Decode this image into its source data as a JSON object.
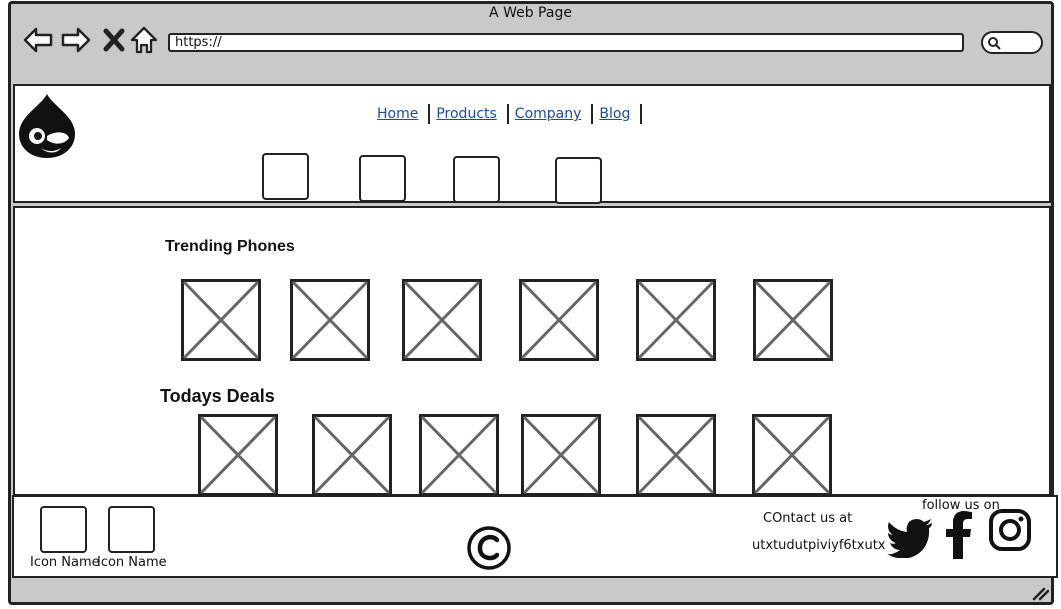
{
  "browser": {
    "window_title": "A Web Page",
    "url": "https://",
    "back_icon": "arrow-left-icon",
    "forward_icon": "arrow-right-icon",
    "stop_icon": "close-icon",
    "home_icon": "home-icon",
    "search_icon": "search-icon"
  },
  "header": {
    "logo_icon": "drupal-drop-icon",
    "nav_links": [
      {
        "label": "Home"
      },
      {
        "label": "Products"
      },
      {
        "label": "Company"
      },
      {
        "label": "Blog"
      }
    ]
  },
  "content": {
    "sections": [
      {
        "title": "Trending Phones",
        "items": 6
      },
      {
        "title": "Todays Deals",
        "items": 6
      }
    ]
  },
  "footer": {
    "icons": [
      {
        "label": "Icon Name"
      },
      {
        "label": "Icon Name"
      }
    ],
    "copyright_icon": "copyright-icon",
    "contact_line1": "COntact us at",
    "contact_line2": "utxtudutpiviyf6txutx",
    "follow_label": "follow us on",
    "social_icons": [
      "twitter-icon",
      "facebook-icon",
      "instagram-icon"
    ]
  },
  "colors": {
    "frame": "#c9c9c9",
    "link": "#1a4d94",
    "stroke": "#222222",
    "placeholder": "#666666"
  }
}
